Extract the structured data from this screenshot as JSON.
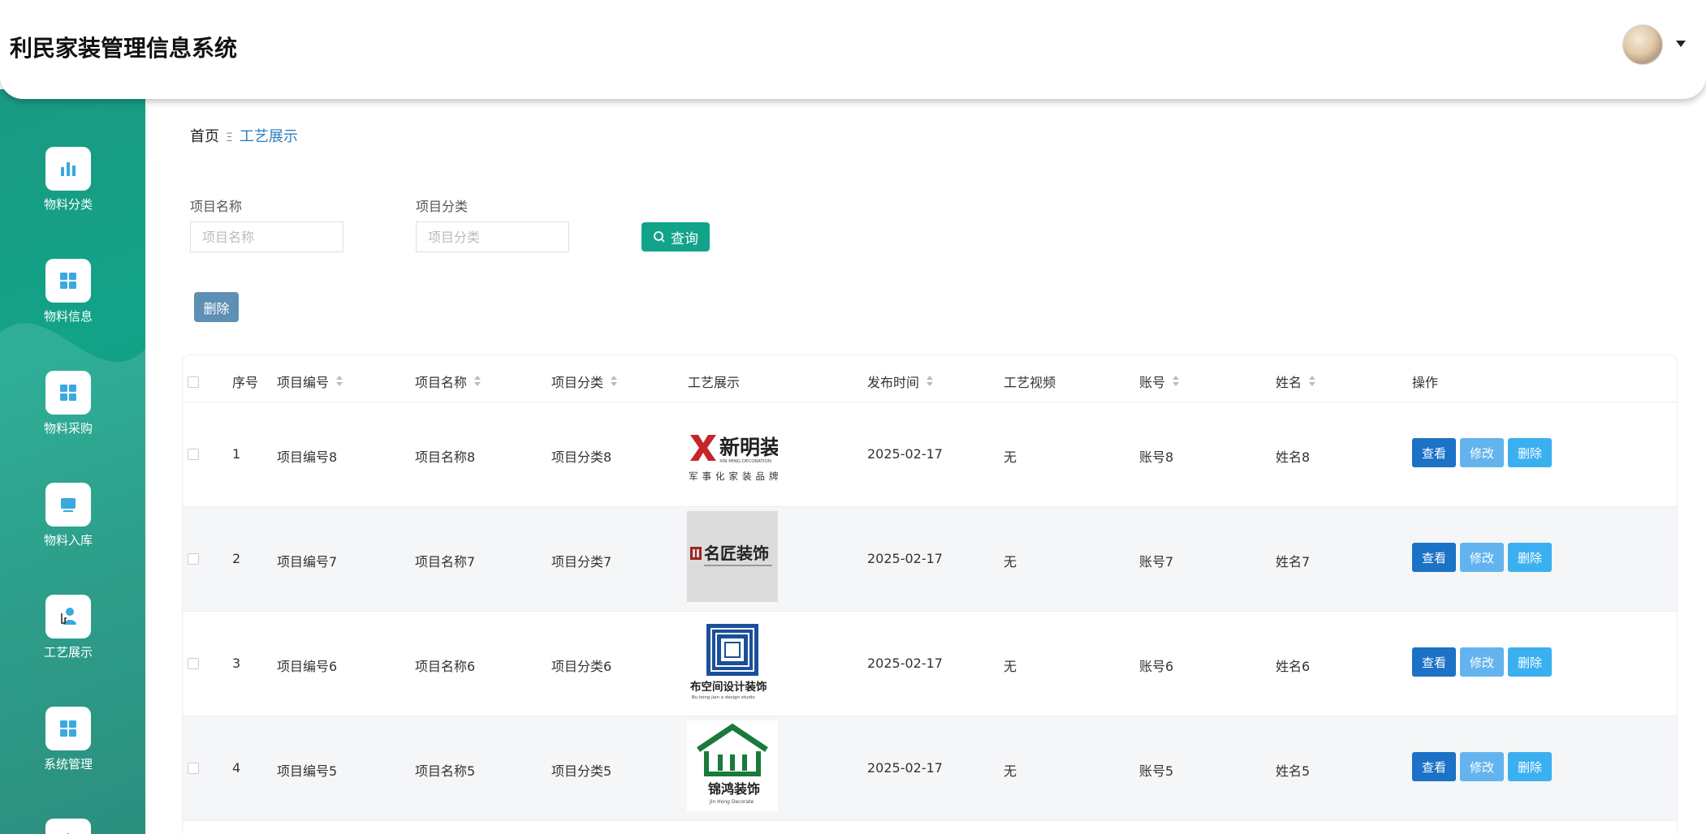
{
  "app": {
    "title": "利民家装管理信息系统"
  },
  "sidebar": {
    "items": [
      {
        "label": "物料分类",
        "icon": "bar-chart-icon"
      },
      {
        "label": "物料信息",
        "icon": "grid-icon"
      },
      {
        "label": "物料采购",
        "icon": "grid-icon"
      },
      {
        "label": "物料入库",
        "icon": "monitor-icon"
      },
      {
        "label": "工艺展示",
        "icon": "user-icon"
      },
      {
        "label": "系统管理",
        "icon": "grid-icon"
      }
    ]
  },
  "breadcrumb": {
    "home": "首页",
    "separator": "Ξ",
    "current": "工艺展示"
  },
  "search": {
    "name_label": "项目名称",
    "name_placeholder": "项目名称",
    "category_label": "项目分类",
    "category_placeholder": "项目分类",
    "query_button": "查询"
  },
  "toolbar": {
    "delete_label": "删除"
  },
  "table": {
    "headers": [
      "序号",
      "项目编号",
      "项目名称",
      "项目分类",
      "工艺展示",
      "发布时间",
      "工艺视频",
      "账号",
      "姓名",
      "操作"
    ],
    "rows": [
      {
        "index": "1",
        "code": "项目编号8",
        "name": "项目名称8",
        "category": "项目分类8",
        "logo_text": "新明装饰",
        "logo_sub": "XIN MING DECORATION",
        "logo_tag": "军事化家装品牌",
        "date": "2025-02-17",
        "video": "无",
        "account": "账号8",
        "person": "姓名8"
      },
      {
        "index": "2",
        "code": "项目编号7",
        "name": "项目名称7",
        "category": "项目分类7",
        "logo_text": "名匠装饰",
        "logo_sub": "",
        "logo_tag": "",
        "date": "2025-02-17",
        "video": "无",
        "account": "账号7",
        "person": "姓名7"
      },
      {
        "index": "3",
        "code": "项目编号6",
        "name": "项目名称6",
        "category": "项目分类6",
        "logo_text": "布空间设计装饰",
        "logo_sub": "Bu kong jian a design studio",
        "logo_tag": "",
        "date": "2025-02-17",
        "video": "无",
        "account": "账号6",
        "person": "姓名6"
      },
      {
        "index": "4",
        "code": "项目编号5",
        "name": "项目名称5",
        "category": "项目分类5",
        "logo_text": "锦鸿装饰",
        "logo_sub": "Jin Hong Decorate",
        "logo_tag": "",
        "date": "2025-02-17",
        "video": "无",
        "account": "账号5",
        "person": "姓名5"
      }
    ],
    "actions": {
      "view": "查看",
      "edit": "修改",
      "delete": "删除"
    }
  },
  "colors": {
    "sidebar": "#12a388",
    "accent": "#12a38b",
    "view_button": "#1b72c6",
    "edit_button": "#63b4ee",
    "delete_button": "#3bb0f0",
    "top_delete": "#5e8fb4"
  }
}
